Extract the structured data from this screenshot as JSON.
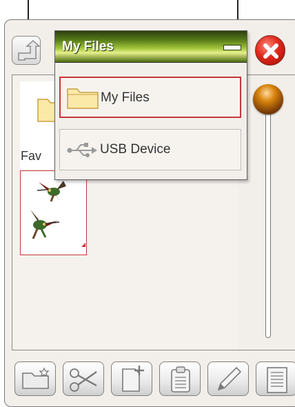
{
  "dropdown": {
    "title": "My Files",
    "items": [
      {
        "label": "My Files",
        "icon": "folder-icon",
        "selected": true
      },
      {
        "label": "USB Device",
        "icon": "usb-icon",
        "selected": false
      }
    ]
  },
  "file_area": {
    "favorites_label": "Fav"
  },
  "toolbar": {
    "buttons": [
      "new-folder-icon",
      "cut-icon",
      "new-file-icon",
      "paste-icon",
      "rename-icon",
      "info-icon"
    ]
  },
  "colors": {
    "header_green": "#5a7d1a",
    "selection_red": "#c4363a",
    "close_red": "#e0281b",
    "knob_orange": "#d9850f"
  }
}
